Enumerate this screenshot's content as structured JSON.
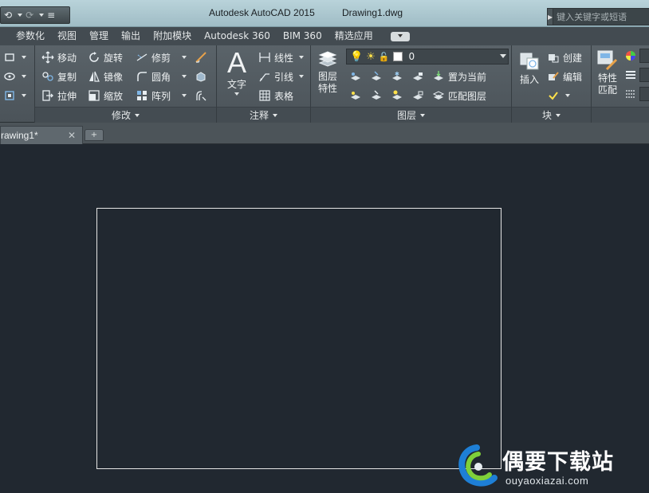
{
  "titlebar": {
    "app_title": "Autodesk AutoCAD 2015",
    "doc_title": "Drawing1.dwg",
    "search_placeholder": "键入关键字或短语",
    "qat_undo": "⟲",
    "qat_redo": "⟳",
    "qat_more": "≡"
  },
  "menu": {
    "tabs": [
      "参数化",
      "视图",
      "管理",
      "输出",
      "附加模块",
      "Autodesk 360",
      "BIM 360",
      "精选应用"
    ]
  },
  "ribbon": {
    "modify": {
      "footer": "修改",
      "move": "移动",
      "rotate": "旋转",
      "trim": "修剪",
      "copy": "复制",
      "mirror": "镜像",
      "fillet": "圆角",
      "stretch": "拉伸",
      "scale": "缩放",
      "array": "阵列"
    },
    "annotate": {
      "footer": "注释",
      "text": "文字",
      "linear": "线性",
      "leader": "引线",
      "table": "表格"
    },
    "layers": {
      "footer": "图层",
      "layer_props_1": "图层",
      "layer_props_2": "特性",
      "current_layer": "0",
      "set_current": "置为当前",
      "match_layer": "匹配图层"
    },
    "block": {
      "footer": "块",
      "insert": "插入",
      "create": "创建",
      "edit": "编辑"
    },
    "properties": {
      "match_1": "特性",
      "match_2": "匹配"
    }
  },
  "doctabs": {
    "active": "rawing1*",
    "close": "✕",
    "new": "+"
  },
  "watermark": {
    "name": "偶要下载站",
    "url": "ouyaoxiazai.com"
  },
  "colors": {
    "canvas": "#212830",
    "ribbon": "#545c62",
    "titlebar": "#a9c4cc"
  }
}
